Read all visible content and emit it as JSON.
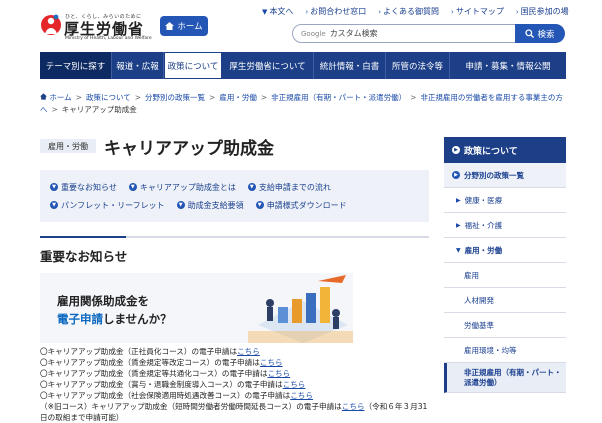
{
  "header": {
    "logo_tagline": "ひと、くらし、みらいのために",
    "logo_name": "厚生労働省",
    "logo_en": "Ministry of Health, Labour and Welfare",
    "home_label": "ホーム",
    "util_links": [
      "本文へ",
      "お問合わせ窓口",
      "よくある御質問",
      "サイトマップ",
      "国民参加の場"
    ],
    "search_brand": "Google",
    "search_placeholder": "カスタム検索",
    "search_button": "検索"
  },
  "nav": {
    "items": [
      "テーマ別に探す",
      "報道・広報",
      "政策について",
      "厚生労働省について",
      "統計情報・白書",
      "所管の法令等",
      "申請・募集・情報公開"
    ]
  },
  "breadcrumb": {
    "items": [
      "ホーム",
      "政策について",
      "分野別の政策一覧",
      "雇用・労働",
      "非正規雇用（有期・パート・派遣労働）",
      "非正規雇用の労働者を雇用する事業主の方へ",
      "キャリアアップ助成金"
    ]
  },
  "page": {
    "category": "雇用・労働",
    "title": "キャリアアップ助成金"
  },
  "anchors": {
    "row1": [
      "重要なお知らせ",
      "キャリアアップ助成金とは",
      "支給申請までの流れ"
    ],
    "row2": [
      "パンフレット・リーフレット",
      "助成金支給要領",
      "申請様式ダウンロード"
    ]
  },
  "section": {
    "heading": "重要なお知らせ"
  },
  "banner": {
    "line1": "雇用関係助成金を",
    "line2_highlight": "電子申請",
    "line2_rest": "しませんか？"
  },
  "notices": {
    "link_text": "こちら",
    "rows": [
      "〇キャリアアップ助成金（正社員化コース）の電子申請は",
      "〇キャリアアップ助成金（賃金規定等改定コース）の電子申請は",
      "〇キャリアアップ助成金（賃金規定等共通化コース）の電子申請は",
      "〇キャリアアップ助成金（賞与・退職金制度導入コース）の電子申請は",
      "〇キャリアアップ助成金（社会保険適用時処遇改善コース）の電子申請は",
      "（※旧コース）キャリアアップ助成金（短時間労働者労働時間延長コース）の電子申請は"
    ],
    "last_suffix": "（令和６年３月31",
    "last_line2": "日の取組まで申請可能）"
  },
  "side": {
    "heading": "政策について",
    "sub": "分野別の政策一覧",
    "items": [
      "健康・医療",
      "福祉・介護",
      "雇用・労働"
    ],
    "children": [
      "雇用",
      "人材開発",
      "労働基準",
      "雇用環境・均等",
      "非正規雇用（有期・パート・派遣労働）"
    ]
  }
}
